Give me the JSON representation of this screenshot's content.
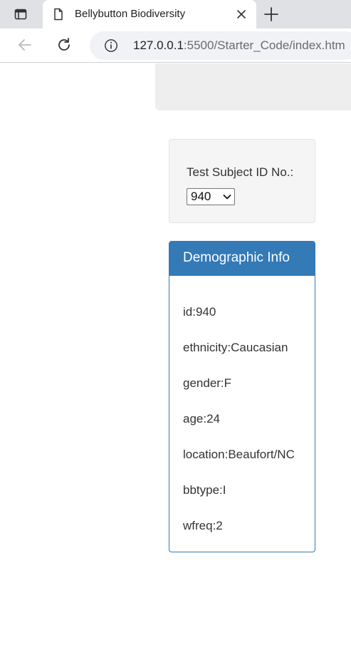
{
  "browser": {
    "tab_title": "Bellybutton Biodiversity",
    "url_host": "127.0.0.1",
    "url_rest": ":5500/Starter_Code/index.htm"
  },
  "selector": {
    "label": "Test Subject ID No.:",
    "value": "940"
  },
  "demographics": {
    "heading": "Demographic Info",
    "items": [
      "id:940",
      "ethnicity:Caucasian",
      "gender:F",
      "age:24",
      "location:Beaufort/NC",
      "bbtype:I",
      "wfreq:2"
    ]
  },
  "colors": {
    "panel_primary": "#337ab7",
    "well_background": "#f5f5f5",
    "jumbotron_background": "#eeeeee"
  }
}
